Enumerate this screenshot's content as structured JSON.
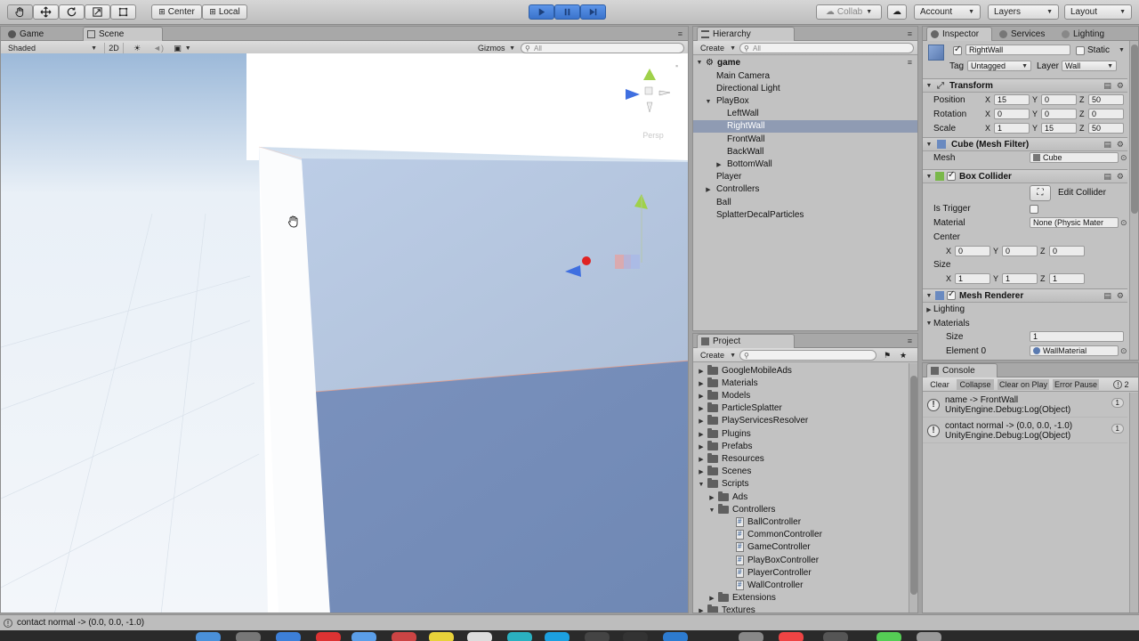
{
  "toolbar": {
    "pivot_label": "Center",
    "space_label": "Local",
    "collab_label": "Collab",
    "account_label": "Account",
    "layers_label": "Layers",
    "layout_label": "Layout"
  },
  "scene_panel": {
    "tabs": [
      {
        "label": "Game"
      },
      {
        "label": "Scene"
      }
    ],
    "shading_mode": "Shaded",
    "mode_2d": "2D",
    "gizmos_label": "Gizmos",
    "search_placeholder": "All",
    "gizmo_label": "Persp"
  },
  "hierarchy": {
    "title": "Hierarchy",
    "create_label": "Create",
    "search_placeholder": "All",
    "scene_name": "game",
    "items": [
      {
        "label": "Main Camera",
        "depth": 1,
        "arrow": "",
        "selected": false
      },
      {
        "label": "Directional Light",
        "depth": 1,
        "arrow": "",
        "selected": false
      },
      {
        "label": "PlayBox",
        "depth": 1,
        "arrow": "▼",
        "selected": false
      },
      {
        "label": "LeftWall",
        "depth": 2,
        "arrow": "",
        "selected": false
      },
      {
        "label": "RightWall",
        "depth": 2,
        "arrow": "",
        "selected": true
      },
      {
        "label": "FrontWall",
        "depth": 2,
        "arrow": "",
        "selected": false
      },
      {
        "label": "BackWall",
        "depth": 2,
        "arrow": "",
        "selected": false
      },
      {
        "label": "BottomWall",
        "depth": 2,
        "arrow": "▶",
        "selected": false
      },
      {
        "label": "Player",
        "depth": 1,
        "arrow": "",
        "selected": false
      },
      {
        "label": "Controllers",
        "depth": 1,
        "arrow": "▶",
        "selected": false
      },
      {
        "label": "Ball",
        "depth": 1,
        "arrow": "",
        "selected": false
      },
      {
        "label": "SplatterDecalParticles",
        "depth": 1,
        "arrow": "",
        "selected": false
      }
    ]
  },
  "project": {
    "title": "Project",
    "create_label": "Create",
    "items": [
      {
        "label": "GoogleMobileAds",
        "depth": 0,
        "arrow": "▶",
        "kind": "folder"
      },
      {
        "label": "Materials",
        "depth": 0,
        "arrow": "▶",
        "kind": "folder"
      },
      {
        "label": "Models",
        "depth": 0,
        "arrow": "▶",
        "kind": "folder"
      },
      {
        "label": "ParticleSplatter",
        "depth": 0,
        "arrow": "▶",
        "kind": "folder"
      },
      {
        "label": "PlayServicesResolver",
        "depth": 0,
        "arrow": "▶",
        "kind": "folder"
      },
      {
        "label": "Plugins",
        "depth": 0,
        "arrow": "▶",
        "kind": "folder"
      },
      {
        "label": "Prefabs",
        "depth": 0,
        "arrow": "▶",
        "kind": "folder"
      },
      {
        "label": "Resources",
        "depth": 0,
        "arrow": "▶",
        "kind": "folder"
      },
      {
        "label": "Scenes",
        "depth": 0,
        "arrow": "▶",
        "kind": "folder"
      },
      {
        "label": "Scripts",
        "depth": 0,
        "arrow": "▼",
        "kind": "folder"
      },
      {
        "label": "Ads",
        "depth": 1,
        "arrow": "▶",
        "kind": "folder"
      },
      {
        "label": "Controllers",
        "depth": 1,
        "arrow": "▼",
        "kind": "folder"
      },
      {
        "label": "BallController",
        "depth": 2,
        "arrow": "",
        "kind": "script"
      },
      {
        "label": "CommonController",
        "depth": 2,
        "arrow": "",
        "kind": "script"
      },
      {
        "label": "GameController",
        "depth": 2,
        "arrow": "",
        "kind": "script"
      },
      {
        "label": "PlayBoxController",
        "depth": 2,
        "arrow": "",
        "kind": "script"
      },
      {
        "label": "PlayerController",
        "depth": 2,
        "arrow": "",
        "kind": "script"
      },
      {
        "label": "WallController",
        "depth": 2,
        "arrow": "",
        "kind": "script"
      },
      {
        "label": "Extensions",
        "depth": 1,
        "arrow": "▶",
        "kind": "folder"
      },
      {
        "label": "Textures",
        "depth": 0,
        "arrow": "▶",
        "kind": "folder"
      }
    ]
  },
  "inspector": {
    "tabs": [
      {
        "label": "Inspector"
      },
      {
        "label": "Services"
      },
      {
        "label": "Lighting"
      }
    ],
    "object_name": "RightWall",
    "static_label": "Static",
    "tag_label": "Tag",
    "tag_value": "Untagged",
    "layer_label": "Layer",
    "layer_value": "Wall",
    "transform": {
      "title": "Transform",
      "position_label": "Position",
      "rotation_label": "Rotation",
      "scale_label": "Scale",
      "position": {
        "x": "15",
        "y": "0",
        "z": "50"
      },
      "rotation": {
        "x": "0",
        "y": "0",
        "z": "0"
      },
      "scale": {
        "x": "1",
        "y": "15",
        "z": "50"
      }
    },
    "mesh_filter": {
      "title": "Cube (Mesh Filter)",
      "mesh_label": "Mesh",
      "mesh_value": "Cube"
    },
    "box_collider": {
      "title": "Box Collider",
      "edit_label": "Edit Collider",
      "is_trigger_label": "Is Trigger",
      "material_label": "Material",
      "material_value": "None (Physic Mater",
      "center_label": "Center",
      "size_label": "Size",
      "center": {
        "x": "0",
        "y": "0",
        "z": "0"
      },
      "size": {
        "x": "1",
        "y": "1",
        "z": "1"
      }
    },
    "mesh_renderer": {
      "title": "Mesh Renderer",
      "lighting_label": "Lighting",
      "materials_label": "Materials",
      "size_label": "Size",
      "size_value": "1",
      "element_label": "Element 0",
      "element_value": "WallMaterial"
    },
    "axis": {
      "x": "X",
      "y": "Y",
      "z": "Z"
    }
  },
  "console": {
    "title": "Console",
    "buttons": {
      "clear": "Clear",
      "collapse": "Collapse",
      "clear_on_play": "Clear on Play",
      "error_pause": "Error Pause"
    },
    "badge_count": "2",
    "entries": [
      {
        "line1": "name -> FrontWall",
        "line2": "UnityEngine.Debug:Log(Object)",
        "count": "1"
      },
      {
        "line1": "contact normal -> (0.0, 0.0, -1.0)",
        "line2": "UnityEngine.Debug:Log(Object)",
        "count": "1"
      }
    ]
  },
  "status_bar": {
    "message": "contact normal -> (0.0, 0.0, -1.0)"
  }
}
